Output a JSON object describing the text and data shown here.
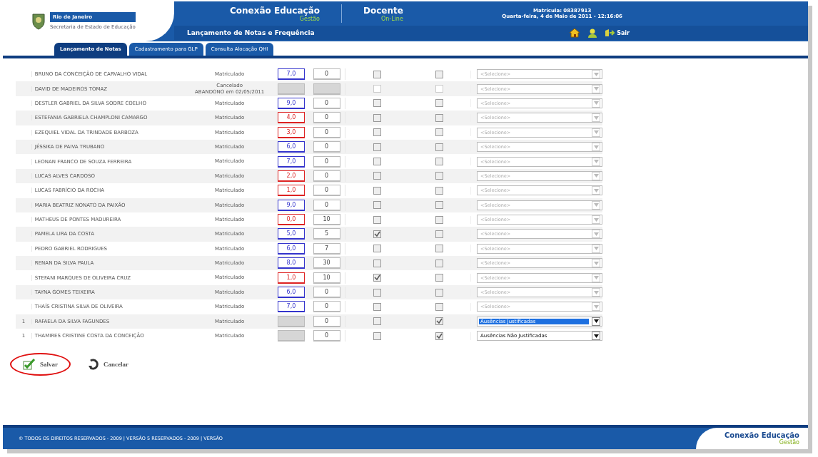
{
  "header": {
    "logo": {
      "title": "Rio de Janeiro",
      "subtitle": "Secretaria de Estado de Educação"
    },
    "system": {
      "title": "Conexão Educação",
      "subtitle": "Gestão"
    },
    "profile": {
      "title": "Docente",
      "subtitle": "On-Line"
    },
    "registration": "Matrícula: 08387913",
    "datetime": "Quarta-feira, 4 de Maio de 2011 - 12:16:06",
    "page_title": "Lançamento de Notas e Frequência",
    "logout": "Sair"
  },
  "tabs": [
    {
      "label": "Lançamento de Notas",
      "selected": true
    },
    {
      "label": "Cadastramento para GLP",
      "selected": false
    },
    {
      "label": "Consulta Alocação QHI",
      "selected": false
    }
  ],
  "rows": [
    {
      "index": "",
      "name": "BRUNO DA CONCEIÇÃO DE CARVALHO VIDAL",
      "status": [
        "Matriculado"
      ],
      "grade": "7,0",
      "color": "#3333cc",
      "absences": "0",
      "disabled": false,
      "check_a": false,
      "check_b": false,
      "option": "<Selecione>",
      "highlighted": false
    },
    {
      "index": "",
      "name": "DAVID DE MADEIROS TOMAZ",
      "status": [
        "Cancelado",
        "ABANDONO em 02/05/2011"
      ],
      "grade": "",
      "absences": "",
      "disabled": true,
      "check_a": false,
      "check_b": false,
      "option": "<Selecione>",
      "highlighted": false
    },
    {
      "index": "",
      "name": "DESTLER GABRIEL DA SILVA SODRE COELHO",
      "status": [
        "Matriculado"
      ],
      "grade": "9,0",
      "color": "#3333cc",
      "absences": "0",
      "disabled": false,
      "check_a": false,
      "check_b": false,
      "option": "<Selecione>",
      "highlighted": false
    },
    {
      "index": "",
      "name": "ESTEFANIA GABRIELA CHAMPLONI CAMARGO",
      "status": [
        "Matriculado"
      ],
      "grade": "4,0",
      "color": "#dd2222",
      "absences": "0",
      "disabled": false,
      "check_a": false,
      "check_b": false,
      "option": "<Selecione>",
      "highlighted": false
    },
    {
      "index": "",
      "name": "EZEQUIEL VIDAL DA TRINDADE BARBOZA",
      "status": [
        "Matriculado"
      ],
      "grade": "3,0",
      "color": "#dd2222",
      "absences": "0",
      "disabled": false,
      "check_a": false,
      "check_b": false,
      "option": "<Selecione>",
      "highlighted": false
    },
    {
      "index": "",
      "name": "JÉSSIKA DE PAIVA TRUBANO",
      "status": [
        "Matriculado"
      ],
      "grade": "6,0",
      "color": "#3333cc",
      "absences": "0",
      "disabled": false,
      "check_a": false,
      "check_b": false,
      "option": "<Selecione>",
      "highlighted": false
    },
    {
      "index": "",
      "name": "LEONAN FRANCO DE SOUZA FERREIRA",
      "status": [
        "Matriculado"
      ],
      "grade": "7,0",
      "color": "#3333cc",
      "absences": "0",
      "disabled": false,
      "check_a": false,
      "check_b": false,
      "option": "<Selecione>",
      "highlighted": false
    },
    {
      "index": "",
      "name": "LUCAS ALVES CARDOSO",
      "status": [
        "Matriculado"
      ],
      "grade": "2,0",
      "color": "#dd2222",
      "absences": "0",
      "disabled": false,
      "check_a": false,
      "check_b": false,
      "option": "<Selecione>",
      "highlighted": false
    },
    {
      "index": "",
      "name": "LUCAS FABRÍCIO DA ROCHA",
      "status": [
        "Matriculado"
      ],
      "grade": "1,0",
      "color": "#dd2222",
      "absences": "0",
      "disabled": false,
      "check_a": false,
      "check_b": false,
      "option": "<Selecione>",
      "highlighted": false
    },
    {
      "index": "",
      "name": "MARIA BEATRIZ NONATO DA PAIXÃO",
      "status": [
        "Matriculado"
      ],
      "grade": "9,0",
      "color": "#3333cc",
      "absences": "0",
      "disabled": false,
      "check_a": false,
      "check_b": false,
      "option": "<Selecione>",
      "highlighted": false
    },
    {
      "index": "",
      "name": "MATHEUS DE PONTES MADUREIRA",
      "status": [
        "Matriculado"
      ],
      "grade": "0,0",
      "color": "#dd2222",
      "absences": "10",
      "disabled": false,
      "check_a": false,
      "check_b": false,
      "option": "<Selecione>",
      "highlighted": false
    },
    {
      "index": "",
      "name": "PAMELA LIRA DA COSTA",
      "status": [
        "Matriculado"
      ],
      "grade": "5,0",
      "color": "#3333cc",
      "absences": "5",
      "disabled": false,
      "check_a": true,
      "check_b": false,
      "option": "<Selecione>",
      "highlighted": false
    },
    {
      "index": "",
      "name": "PEDRO GABRIEL RODRIGUES",
      "status": [
        "Matriculado"
      ],
      "grade": "6,0",
      "color": "#3333cc",
      "absences": "7",
      "disabled": false,
      "check_a": false,
      "check_b": false,
      "option": "<Selecione>",
      "highlighted": false
    },
    {
      "index": "",
      "name": "RENAN DA SILVA PAULA",
      "status": [
        "Matriculado"
      ],
      "grade": "8,0",
      "color": "#3333cc",
      "absences": "30",
      "disabled": false,
      "check_a": false,
      "check_b": false,
      "option": "<Selecione>",
      "highlighted": false
    },
    {
      "index": "",
      "name": "STEFANI MARQUES DE OLIVEIRA CRUZ",
      "status": [
        "Matriculado"
      ],
      "grade": "1,0",
      "color": "#dd2222",
      "absences": "10",
      "disabled": false,
      "check_a": true,
      "check_b": false,
      "option": "<Selecione>",
      "highlighted": false
    },
    {
      "index": "",
      "name": "TAYNA GOMES TEIXEIRA",
      "status": [
        "Matriculado"
      ],
      "grade": "6,0",
      "color": "#3333cc",
      "absences": "0",
      "disabled": false,
      "check_a": false,
      "check_b": false,
      "option": "<Selecione>",
      "highlighted": false
    },
    {
      "index": "",
      "name": "THAÍS CRISTINA SILVA DE OLIVEIRA",
      "status": [
        "Matriculado"
      ],
      "grade": "7,0",
      "color": "#3333cc",
      "absences": "0",
      "disabled": false,
      "check_a": false,
      "check_b": false,
      "option": "<Selecione>",
      "highlighted": false
    },
    {
      "index": "1",
      "name": "RAFAELA DA SILVA FAGUNDES",
      "status": [
        "Matriculado"
      ],
      "grade": "",
      "absences": "0",
      "disabled": false,
      "check_a": false,
      "check_b": true,
      "option": "Ausências Justificadas",
      "highlighted": true
    },
    {
      "index": "1",
      "name": "THAMIRES CRISTINE COSTA DA CONCEIÇÃO",
      "status": [
        "Matriculado"
      ],
      "grade": "",
      "absences": "0",
      "disabled": false,
      "check_a": false,
      "check_b": true,
      "option": "Ausências Não Justificadas",
      "highlighted": false
    }
  ],
  "actions": [
    {
      "label": "Salvar",
      "kind": "save",
      "circled": true
    },
    {
      "label": "Cancelar",
      "kind": "cancel",
      "circled": false
    }
  ],
  "footer": {
    "copyright": "© TODOS OS DIREITOS RESERVADOS - 2009 | VERSÃO 5 RESERVADOS - 2009 | VERSÃO",
    "logo_title": "Conexão Educação",
    "logo_subtitle": "Gestão"
  }
}
